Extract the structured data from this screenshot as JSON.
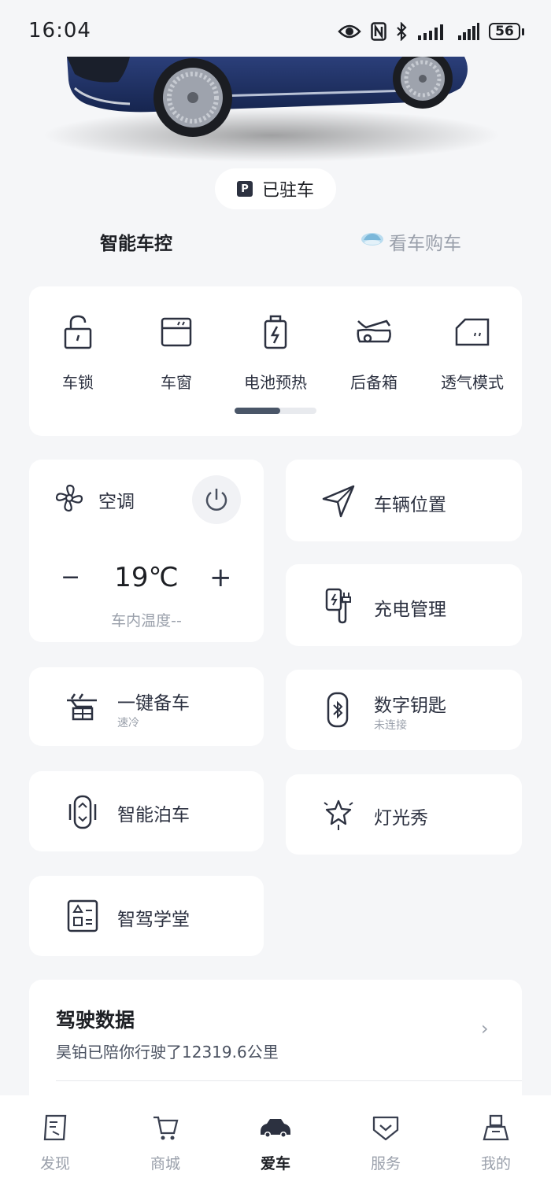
{
  "status_bar": {
    "time": "16:04",
    "battery": "56"
  },
  "parked_label": "已驻车",
  "tabs": {
    "control": "智能车控",
    "buy": "看车购车"
  },
  "quick_controls": [
    {
      "label": "车锁",
      "icon": "lock-icon"
    },
    {
      "label": "车窗",
      "icon": "window-icon"
    },
    {
      "label": "电池预热",
      "icon": "battery-preheat-icon"
    },
    {
      "label": "后备箱",
      "icon": "trunk-icon"
    },
    {
      "label": "透气模式",
      "icon": "ventilation-icon"
    }
  ],
  "quick_scroll_progress": 0.56,
  "ac": {
    "title": "空调",
    "temperature": "19℃",
    "minus": "−",
    "plus": "+",
    "cabin_temp": "车内温度--"
  },
  "tiles": {
    "location": {
      "title": "车辆位置"
    },
    "charging": {
      "title": "充电管理"
    },
    "prep": {
      "title": "一键备车",
      "sub": "速冷"
    },
    "key": {
      "title": "数字钥匙",
      "sub": "未连接"
    },
    "parking": {
      "title": "智能泊车"
    },
    "lightshow": {
      "title": "灯光秀"
    },
    "academy": {
      "title": "智驾学堂"
    }
  },
  "driving_data": {
    "title": "驾驶数据",
    "desc": "昊铂已陪你行驶了12319.6公里",
    "chevron": "›"
  },
  "nav": [
    {
      "label": "发现",
      "icon": "discover-icon"
    },
    {
      "label": "商城",
      "icon": "cart-icon"
    },
    {
      "label": "爱车",
      "icon": "car-icon"
    },
    {
      "label": "服务",
      "icon": "service-icon"
    },
    {
      "label": "我的",
      "icon": "profile-icon"
    }
  ],
  "colors": {
    "accent": "#2c3140",
    "muted": "#9aa0ab",
    "background": "#f5f6f8",
    "car_body": "#1e2f63"
  }
}
